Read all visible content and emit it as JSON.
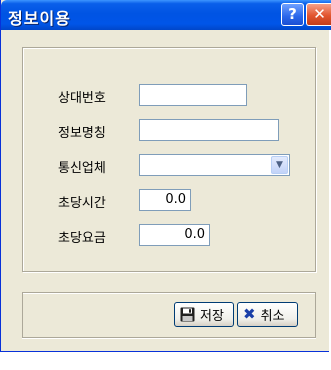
{
  "window": {
    "title": "정보이용",
    "help_glyph": "?",
    "close_glyph": "✕"
  },
  "form": {
    "fields": [
      {
        "label": "상대번호",
        "value": ""
      },
      {
        "label": "정보명칭",
        "value": ""
      },
      {
        "label": "통신업체",
        "value": ""
      },
      {
        "label": "초당시간",
        "value": "0.0"
      },
      {
        "label": "초당요금",
        "value": "0.0"
      }
    ]
  },
  "buttons": {
    "save_label": "저장",
    "cancel_label": "취소"
  },
  "icons": {
    "save": "floppy-disk-icon",
    "cancel": "x-icon",
    "dropdown": "chevron-down-icon"
  },
  "colors": {
    "titlebar": "#0054e3",
    "dialog_bg": "#ece9d8",
    "field_border": "#7f9db9",
    "close_button": "#e2552f"
  }
}
